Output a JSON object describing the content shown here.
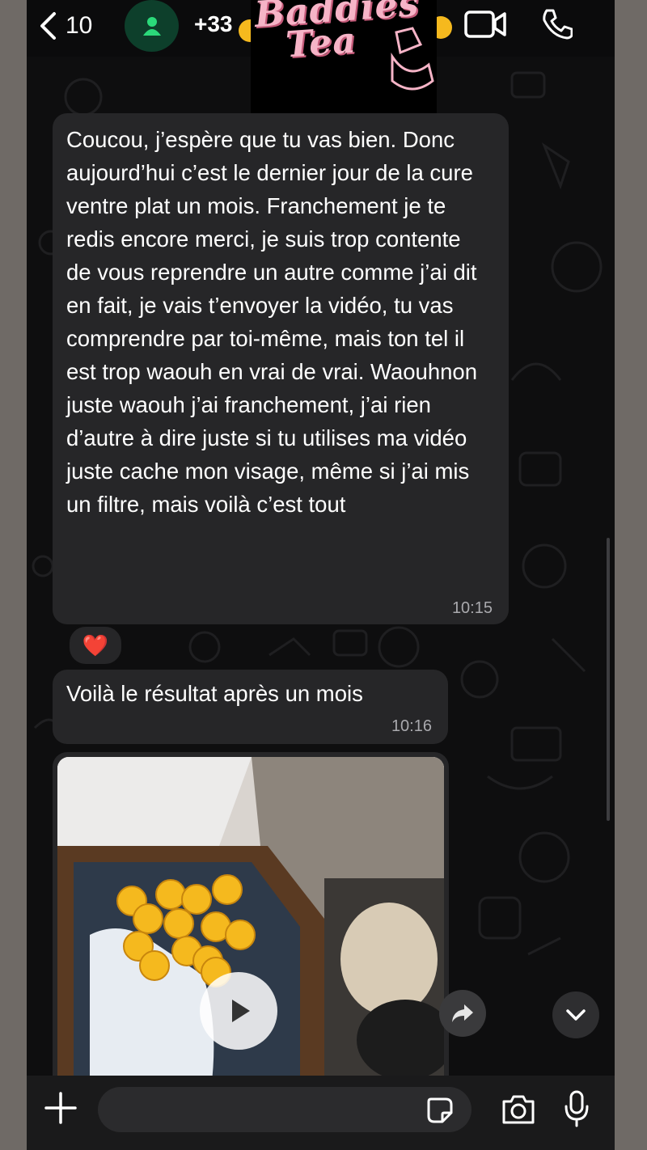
{
  "header": {
    "back_count": "10",
    "contact_number": "+33",
    "sticker_text_line1": "Baddies",
    "sticker_text_line2": "Tea"
  },
  "messages": [
    {
      "text": "Coucou, j’espère que tu vas bien. Donc aujourd’hui c’est le dernier jour de la cure ventre plat un mois. Franchement je te redis encore merci, je suis trop contente de vous reprendre un autre comme j’ai dit en fait, je vais t’envoyer la vidéo, tu vas comprendre par toi-même, mais ton tel il est trop waouh en vrai de vrai. Waouhnon juste waouh j’ai franchement, j’ai rien d’autre à dire juste si tu utilises ma vidéo juste cache mon visage, même si j’ai mis un filtre, mais voilà c’est tout",
      "time": "10:15",
      "reaction": "❤️"
    },
    {
      "text": "Voilà le résultat après un mois",
      "time": "10:16"
    }
  ],
  "video": {
    "type": "video-message"
  },
  "input": {
    "placeholder": ""
  },
  "colors": {
    "bubble": "#262628",
    "background": "#0e0e0f",
    "avatar": "#0d3f2b",
    "avatar_icon": "#2bd97a"
  },
  "icons": [
    "back-chevron-icon",
    "contact-avatar-icon",
    "video-call-icon",
    "phone-call-icon",
    "play-icon",
    "forward-icon",
    "chevron-down-icon",
    "plus-icon",
    "sticker-icon",
    "camera-icon",
    "microphone-icon"
  ]
}
